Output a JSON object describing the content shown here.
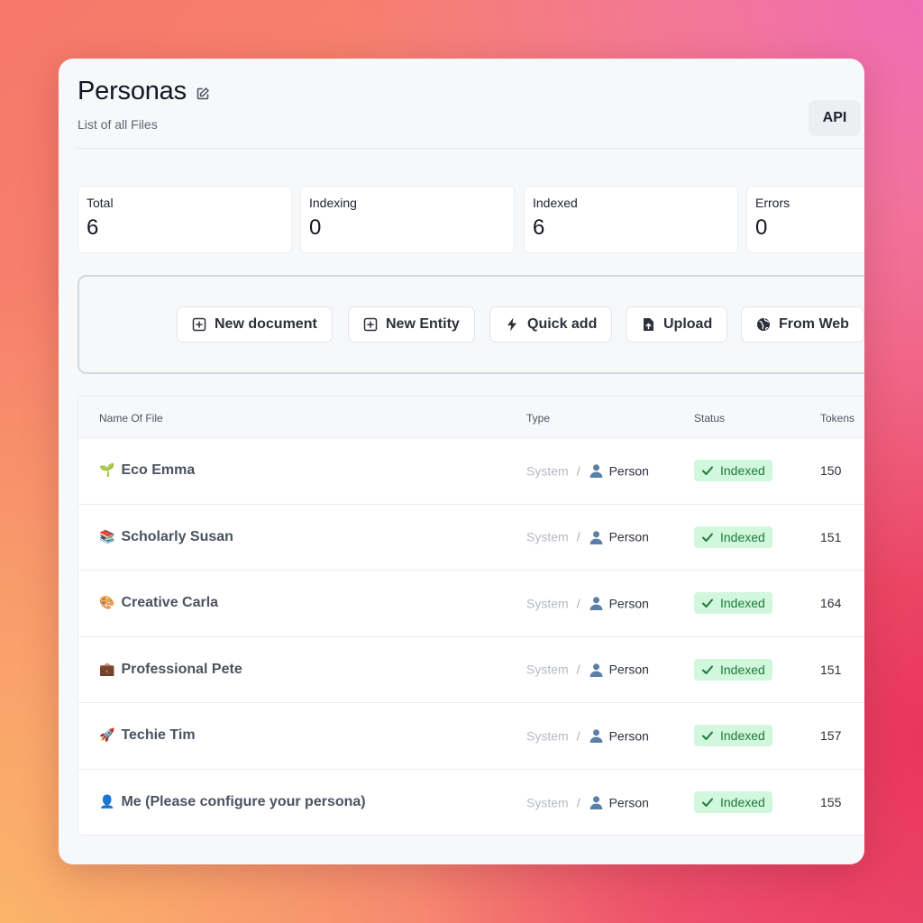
{
  "page": {
    "title": "Personas",
    "subtitle": "List of all Files",
    "api_label": "API"
  },
  "stats": [
    {
      "label": "Total",
      "value": "6"
    },
    {
      "label": "Indexing",
      "value": "0"
    },
    {
      "label": "Indexed",
      "value": "6"
    },
    {
      "label": "Errors",
      "value": "0"
    }
  ],
  "actions": [
    {
      "label": "New document",
      "icon": "plus-square-icon"
    },
    {
      "label": "New Entity",
      "icon": "plus-square-icon"
    },
    {
      "label": "Quick add",
      "icon": "lightning-icon"
    },
    {
      "label": "Upload",
      "icon": "file-upload-icon"
    },
    {
      "label": "From Web",
      "icon": "globe-icon"
    }
  ],
  "table": {
    "columns": [
      "Name Of File",
      "Type",
      "Status",
      "Tokens"
    ],
    "rows": [
      {
        "emoji": "🌱",
        "name": "Eco Emma",
        "type_source": "System",
        "type": "Person",
        "status": "Indexed",
        "tokens": "150"
      },
      {
        "emoji": "📚",
        "name": "Scholarly Susan",
        "type_source": "System",
        "type": "Person",
        "status": "Indexed",
        "tokens": "151"
      },
      {
        "emoji": "🎨",
        "name": "Creative Carla",
        "type_source": "System",
        "type": "Person",
        "status": "Indexed",
        "tokens": "164"
      },
      {
        "emoji": "💼",
        "name": "Professional Pete",
        "type_source": "System",
        "type": "Person",
        "status": "Indexed",
        "tokens": "151"
      },
      {
        "emoji": "🚀",
        "name": "Techie Tim",
        "type_source": "System",
        "type": "Person",
        "status": "Indexed",
        "tokens": "157"
      },
      {
        "emoji": "👤",
        "name": "Me (Please configure your persona)",
        "type_source": "System",
        "type": "Person",
        "status": "Indexed",
        "tokens": "155"
      }
    ]
  },
  "colors": {
    "status_badge_bg": "#d1f7dc",
    "status_badge_text": "#1f7a3d",
    "person_icon": "#5b7fa6"
  }
}
